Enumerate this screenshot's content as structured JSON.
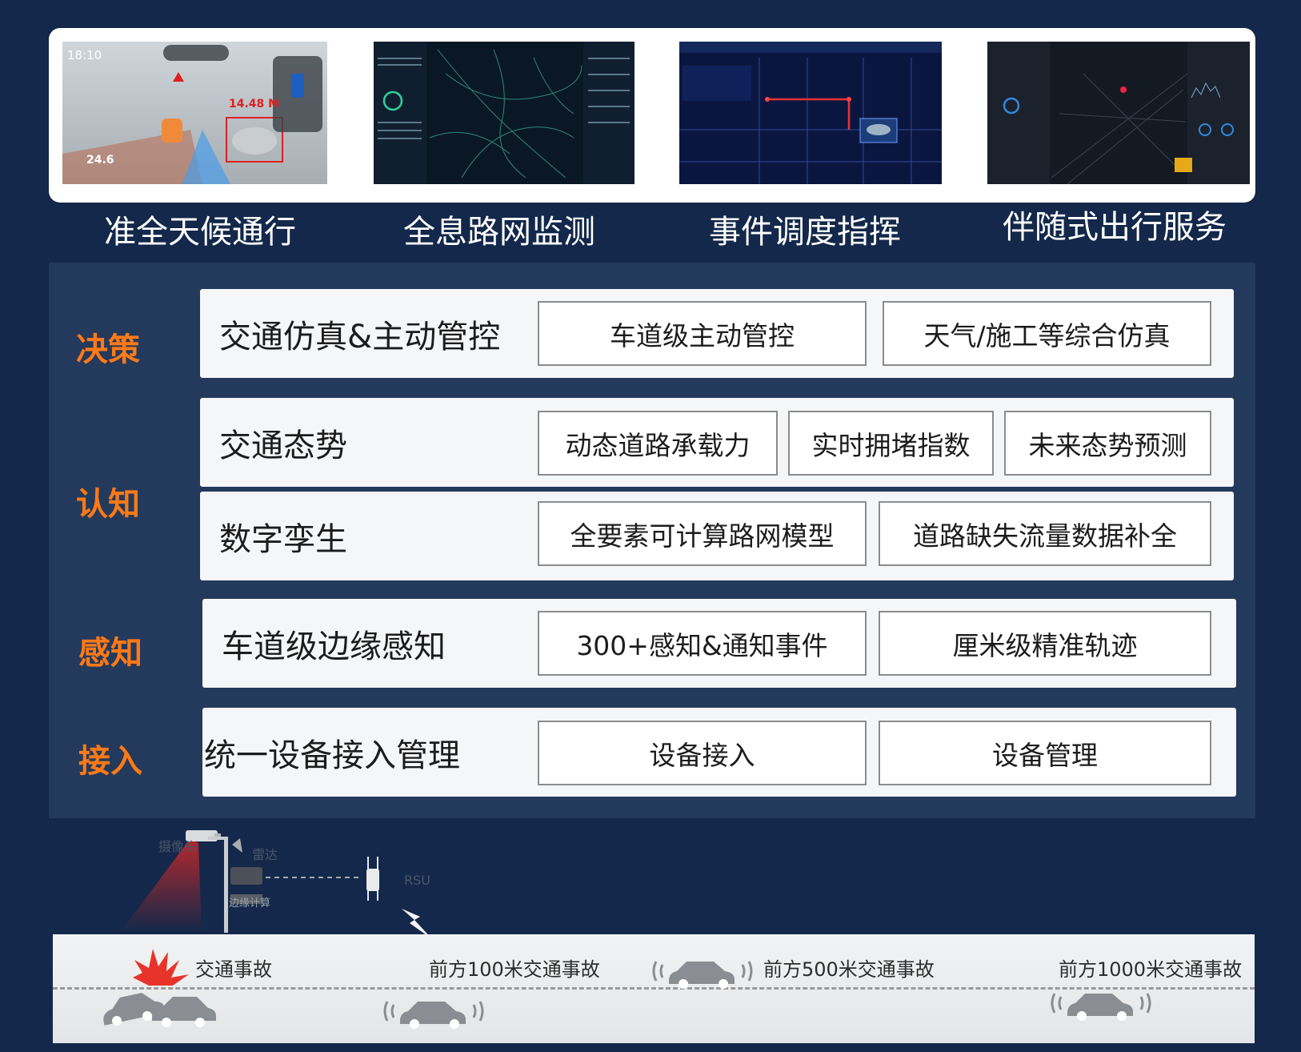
{
  "screenshots": [
    {
      "caption": "准全天候通行",
      "overlay_time": "18:10",
      "overlay_distance": "14.48 M",
      "overlay_speed": "24.6"
    },
    {
      "caption": "全息路网监测"
    },
    {
      "caption": "事件调度指挥"
    },
    {
      "caption": "伴随式出行服务"
    }
  ],
  "architecture": {
    "layers": [
      {
        "label": "决策",
        "rows": [
          {
            "title": "交通仿真&主动管控",
            "items": [
              "车道级主动管控",
              "天气/施工等综合仿真"
            ]
          }
        ]
      },
      {
        "label": "认知",
        "rows": [
          {
            "title": "交通态势",
            "items": [
              "动态道路承载力",
              "实时拥堵指数",
              "未来态势预测"
            ]
          },
          {
            "title": "数字孪生",
            "items": [
              "全要素可计算路网模型",
              "道路缺失流量数据补全"
            ]
          }
        ]
      },
      {
        "label": "感知",
        "rows": [
          {
            "title": "车道级边缘感知",
            "items": [
              "300+感知&通知事件",
              "厘米级精准轨迹"
            ]
          }
        ]
      },
      {
        "label": "接入",
        "rows": [
          {
            "title": "统一设备接入管理",
            "items": [
              "设备接入",
              "设备管理"
            ]
          }
        ]
      }
    ]
  },
  "devices": {
    "camera": "摄像头",
    "radar": "雷达",
    "edge": "边缘计算",
    "rsu": "RSU"
  },
  "road_events": [
    "交通事故",
    "前方100米交通事故",
    "前方500米交通事故",
    "前方1000米交通事故"
  ],
  "colors": {
    "background": "#13284a",
    "panel": "#243a5c",
    "layer_label": "#ff7a16",
    "accident": "#e8332a"
  }
}
